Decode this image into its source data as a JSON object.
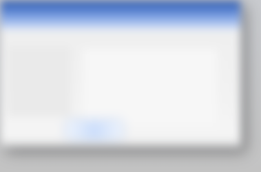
{
  "window": {
    "title": ""
  },
  "actions": {
    "primary_button_label": ""
  },
  "colors": {
    "title_bar": "#5f89d7",
    "window_background": "#ececec",
    "desktop_background": "#c6c6c6",
    "button_highlight": "#c9dcfb"
  }
}
